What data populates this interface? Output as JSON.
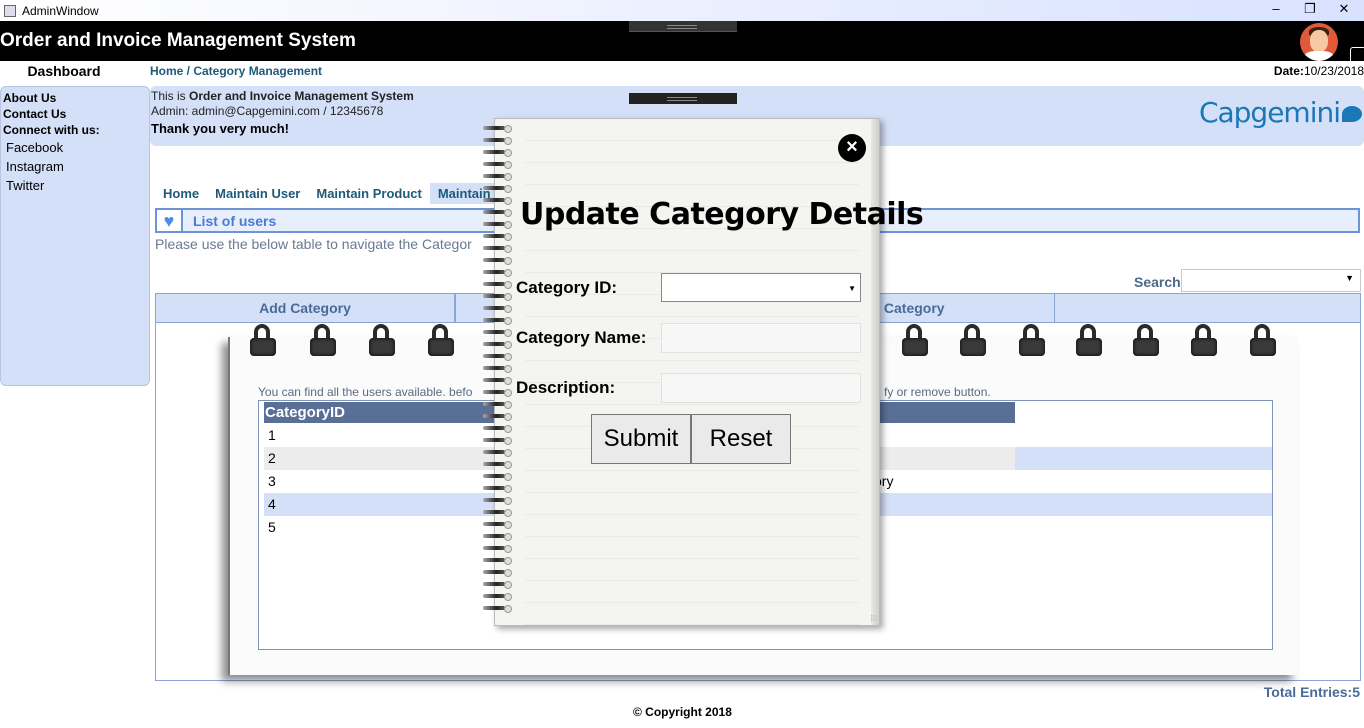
{
  "window": {
    "title": "AdminWindow",
    "min": "‒",
    "max": "❐",
    "close": "✕"
  },
  "header": {
    "app_title": "Order and Invoice Management System"
  },
  "sidebar": {
    "dashboard": "Dashboard",
    "about": "About Us",
    "contact": "Contact Us",
    "connect": "Connect with us:",
    "links": [
      "Facebook",
      "Instagram",
      "Twitter"
    ]
  },
  "breadcrumb": "Home / Category Management",
  "date": {
    "label": "Date:",
    "value": "10/23/2018"
  },
  "info": {
    "line1_prefix": "This is ",
    "line1_strong": "Order and Invoice Management System",
    "line2": "Admin: admin@Capgemini.com / 12345678",
    "line3": "Thank you very much!",
    "logo": "Capgemini"
  },
  "tabs": [
    "Home",
    "Maintain User",
    "Maintain Product",
    "Maintain C"
  ],
  "list": {
    "title": "List of users",
    "hint": "Please use the below table to navigate the Categor"
  },
  "search": {
    "label": "Search"
  },
  "actions": {
    "add": "Add Category",
    "remove": "ve Category"
  },
  "notepad": {
    "hint_left": "You can find all the users available. befo",
    "hint_right": "fy or remove button."
  },
  "grid": {
    "header": "CategoryID",
    "rows": [
      "1",
      "2",
      "3",
      "4",
      "5"
    ],
    "row3_extra": "ory"
  },
  "total": "Total Entries:5",
  "copyright": "© Copyright 2018",
  "modal": {
    "close": "×",
    "title": "Update Category Details",
    "category_id_label": "Category ID:",
    "category_name_label": "Category Name:",
    "description_label": "Description:",
    "category_id_value": "",
    "category_name_value": "",
    "description_value": "",
    "submit": "Submit",
    "reset": "Reset"
  }
}
